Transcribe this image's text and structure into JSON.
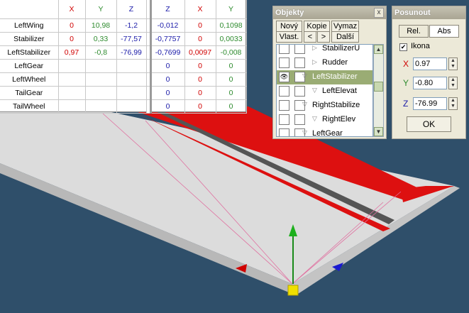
{
  "table": {
    "left_headers": [
      "X",
      "Y",
      "Z"
    ],
    "right_headers": [
      "Z",
      "X",
      "Y"
    ],
    "rows": [
      {
        "name": "LeftWing",
        "x": "0",
        "y": "10,98",
        "z": "-1,2",
        "z2": "-0,012",
        "x2": "0",
        "y2": "0,1098"
      },
      {
        "name": "Stabilizer",
        "x": "0",
        "y": "0,33",
        "z": "-77,57",
        "z2": "-0,7757",
        "x2": "0",
        "y2": "0,0033"
      },
      {
        "name": "LeftStabilizer",
        "x": "0,97",
        "y": "-0,8",
        "z": "-76,99",
        "z2": "-0,7699",
        "x2": "0,0097",
        "y2": "-0,008"
      },
      {
        "name": "LeftGear",
        "x": "",
        "y": "",
        "z": "",
        "z2": "0",
        "x2": "0",
        "y2": "0"
      },
      {
        "name": "LeftWheel",
        "x": "",
        "y": "",
        "z": "",
        "z2": "0",
        "x2": "0",
        "y2": "0"
      },
      {
        "name": "TailGear",
        "x": "",
        "y": "",
        "z": "",
        "z2": "0",
        "x2": "0",
        "y2": "0"
      },
      {
        "name": "TailWheel",
        "x": "",
        "y": "",
        "z": "",
        "z2": "0",
        "x2": "0",
        "y2": "0"
      }
    ]
  },
  "objekty": {
    "title": "Objekty",
    "close": "x",
    "buttons": {
      "new": "Nový",
      "copy": "Kopie",
      "delete": "Vymaz",
      "props": "Vlast.",
      "prev": "<",
      "next": ">",
      "more": "Další"
    },
    "items": [
      {
        "label": "StabilizerU",
        "selected": false
      },
      {
        "label": "Rudder",
        "selected": false
      },
      {
        "label": "LeftStabilizer",
        "selected": true
      },
      {
        "label": "LeftElevat",
        "selected": false
      },
      {
        "label": "RightStabilize",
        "selected": false
      },
      {
        "label": "RightElev",
        "selected": false
      },
      {
        "label": "LeftGear",
        "selected": false
      }
    ]
  },
  "posunout": {
    "title": "Posunout",
    "tab_rel": "Rel.",
    "tab_abs": "Abs",
    "ikona_label": "Ikona",
    "ikona_checked": "✔",
    "x_label": "X",
    "y_label": "Y",
    "z_label": "Z",
    "x_value": "0.97",
    "y_value": "-0.80",
    "z_value": "-76.99",
    "ok": "OK"
  },
  "colors": {
    "x_axis": "#d00000",
    "y_axis": "#2e8b2e",
    "z_axis": "#1a1aa8",
    "wing_stripe": "#dd1010",
    "selection": "#9aac74"
  }
}
